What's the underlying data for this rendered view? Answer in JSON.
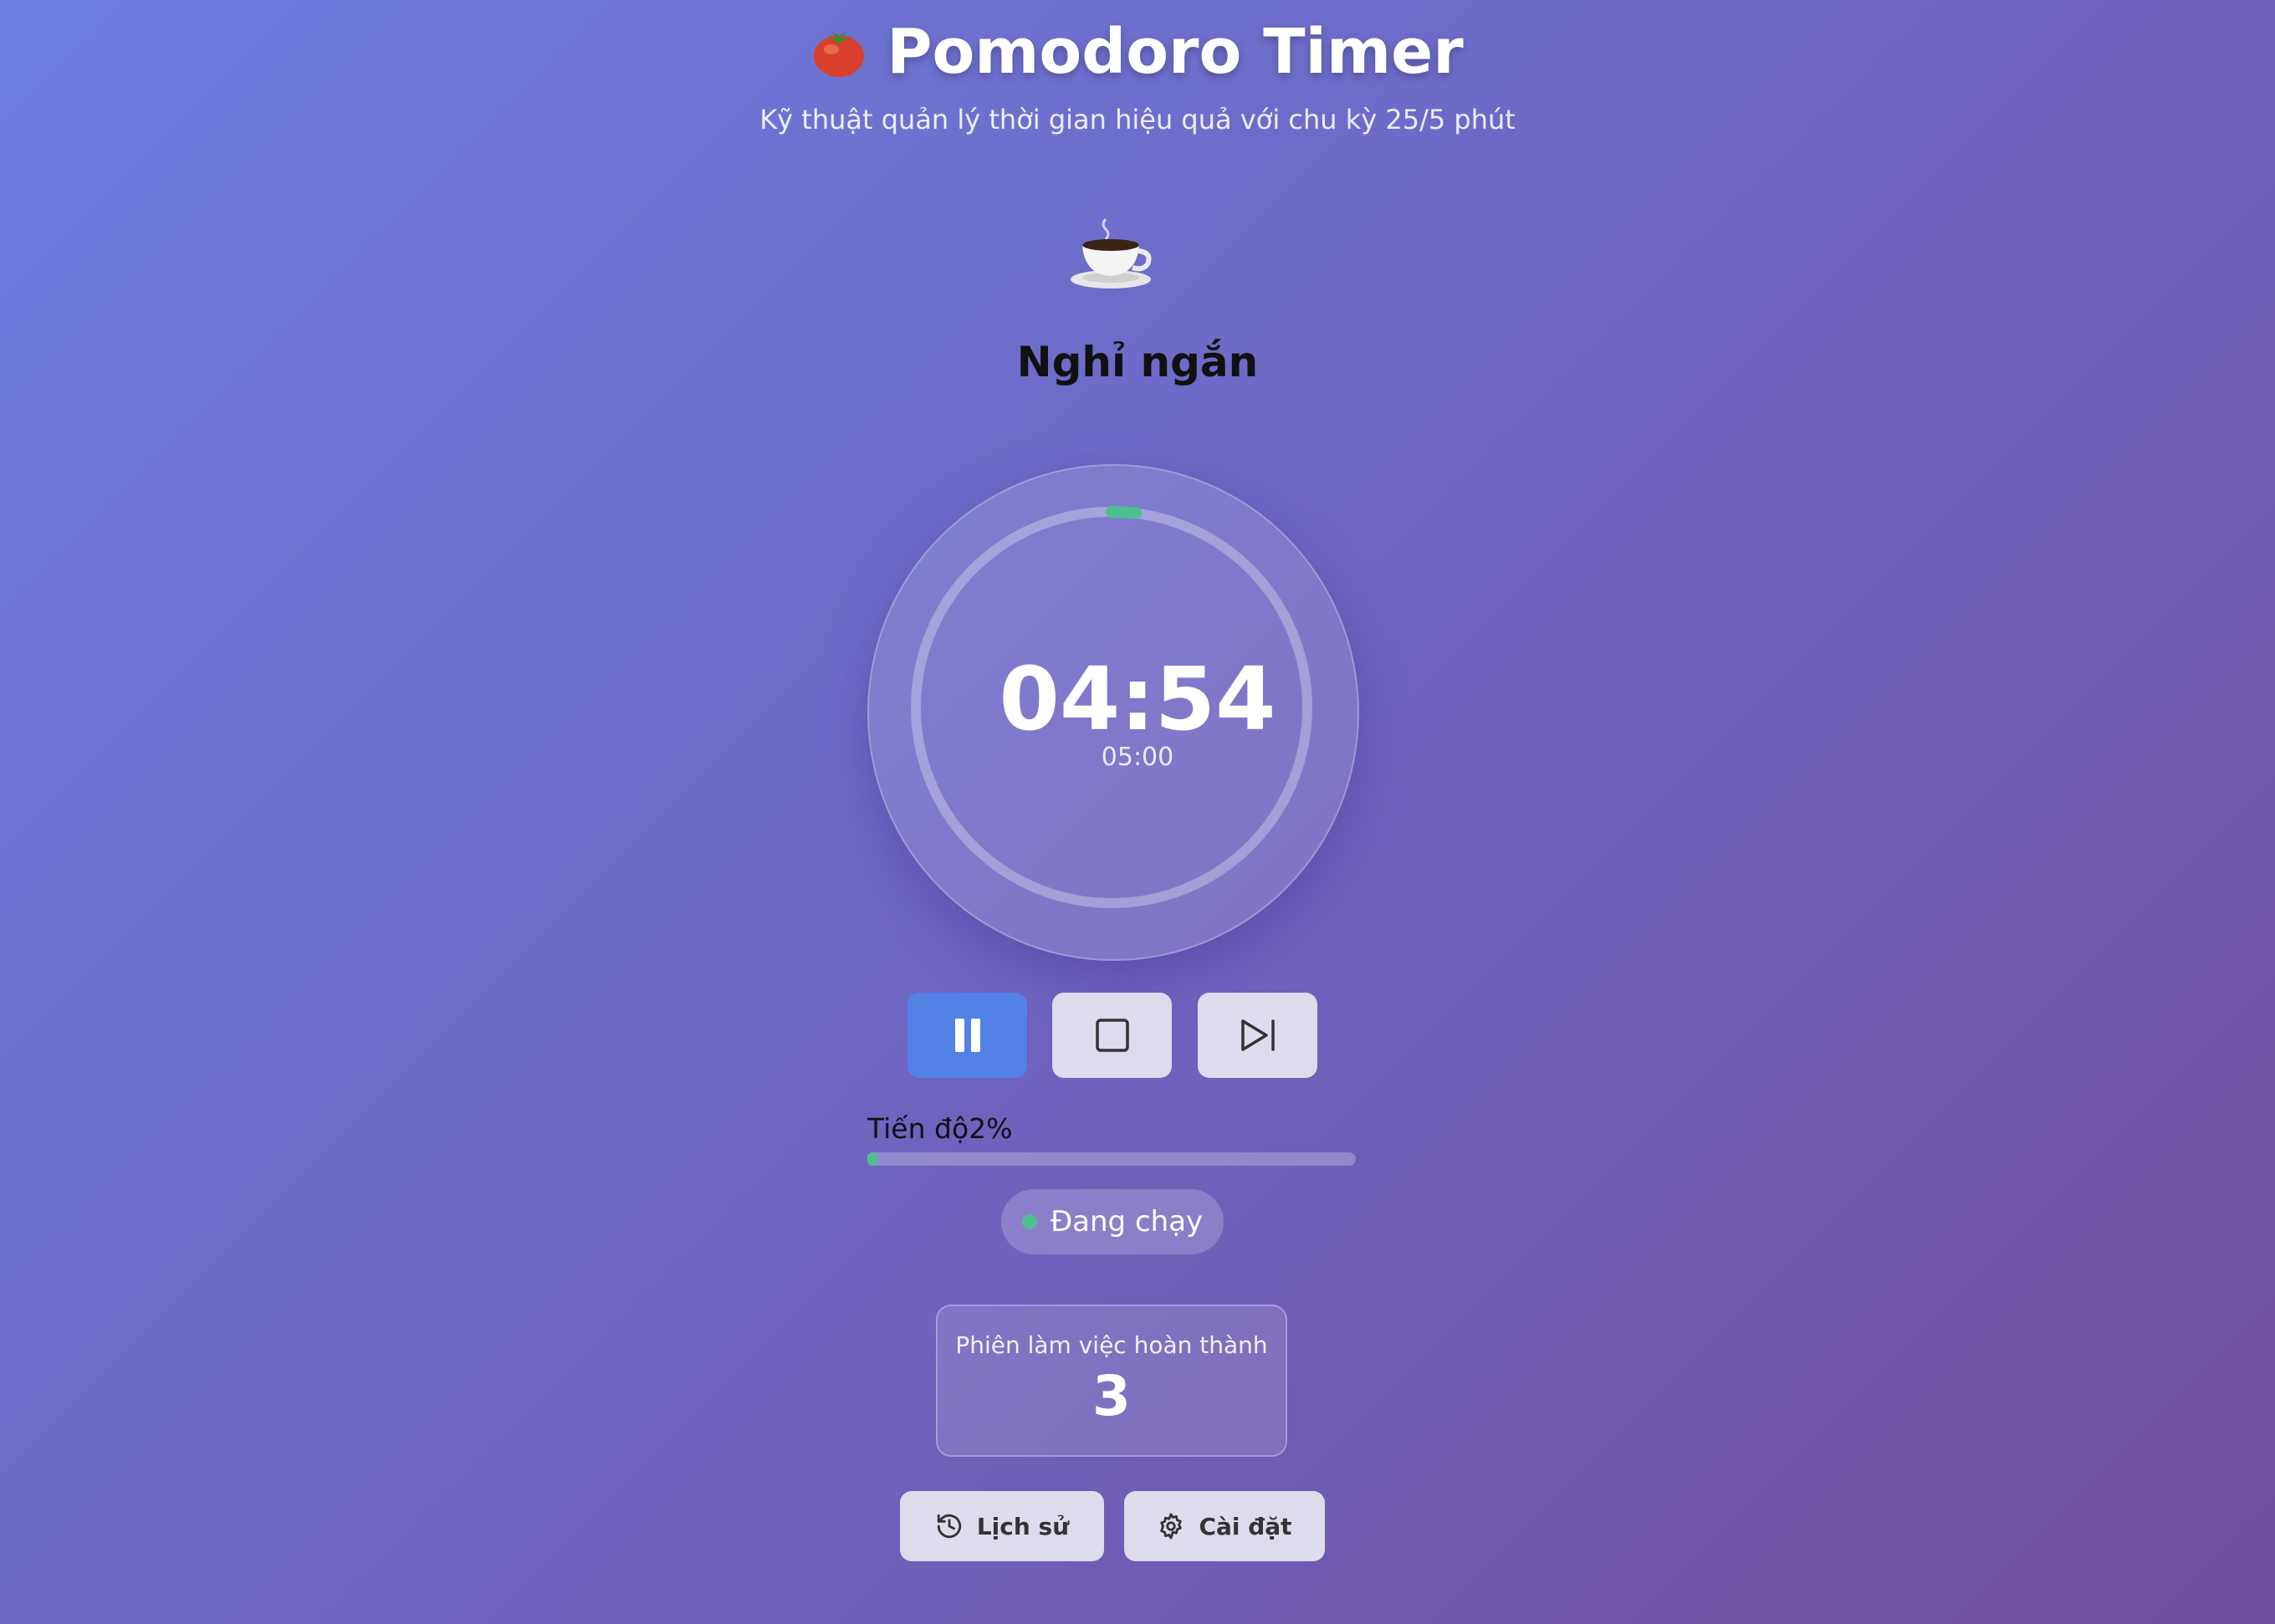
{
  "header": {
    "title": "Pomodoro Timer",
    "subtitle": "Kỹ thuật quản lý thời gian hiệu quả với chu kỳ 25/5 phút",
    "icon": "tomato-icon"
  },
  "mode": {
    "icon": "coffee-cup-icon",
    "label": "Nghỉ ngắn"
  },
  "timer": {
    "remaining": "04:54",
    "total": "05:00",
    "ring_progress": 0.02,
    "ring_color": "#4fc08d"
  },
  "controls": {
    "pause_icon": "pause-icon",
    "stop_icon": "stop-icon",
    "skip_icon": "skip-forward-icon",
    "primary_color": "#5282e6"
  },
  "progress": {
    "label": "Tiến độ",
    "percent_text": "2%",
    "value": 0.02
  },
  "status": {
    "text": "Đang chạy",
    "dot_color": "#4fc08d"
  },
  "stats": {
    "completed_label": "Phiên làm việc hoàn thành",
    "completed_value": "3"
  },
  "footer": {
    "history_label": "Lịch sử",
    "history_icon": "history-icon",
    "settings_label": "Cài đặt",
    "settings_icon": "gear-icon"
  }
}
